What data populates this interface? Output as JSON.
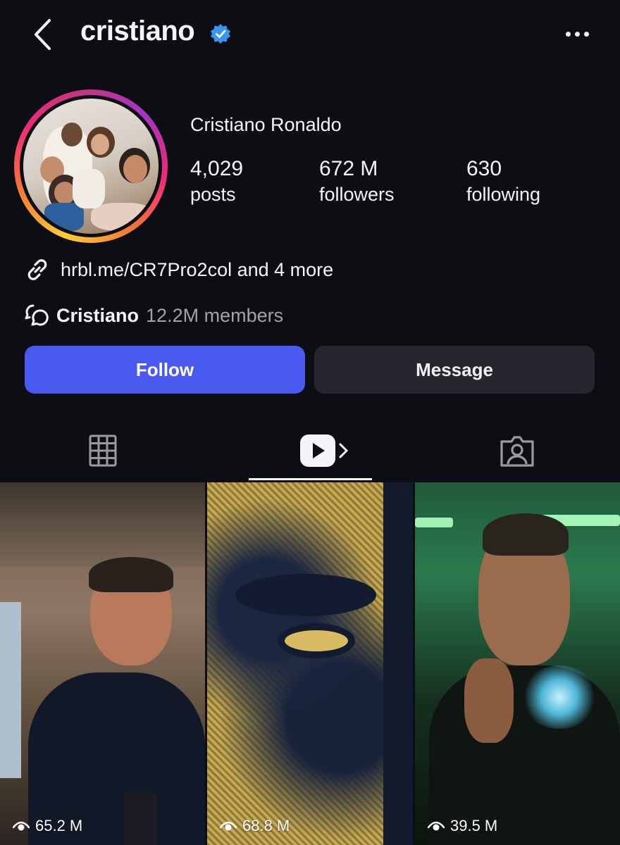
{
  "header": {
    "username": "cristiano",
    "back_icon": "chevron-left-icon",
    "verified_icon": "verified-badge-icon",
    "more_icon": "more-horizontal-icon",
    "accent_color": "#3797f0"
  },
  "profile": {
    "full_name": "Cristiano Ronaldo",
    "stats": [
      {
        "value": "4,029",
        "label": "posts"
      },
      {
        "value": "672 M",
        "label": "followers"
      },
      {
        "value": "630",
        "label": "following"
      }
    ],
    "link": {
      "icon": "link-icon",
      "text": "hrbl.me/CR7Pro2col and 4 more"
    },
    "channel": {
      "icon": "channel-icon",
      "name": "Cristiano",
      "members": "12.2M members"
    }
  },
  "actions": {
    "follow_label": "Follow",
    "message_label": "Message",
    "follow_color": "#4a5af0",
    "message_color": "#26272e"
  },
  "tabs": [
    {
      "name": "grid",
      "icon": "grid-icon",
      "active": false
    },
    {
      "name": "reels",
      "icon": "reels-play-icon",
      "active": true
    },
    {
      "name": "tagged",
      "icon": "tagged-person-icon",
      "active": false
    }
  ],
  "reels": [
    {
      "views": "65.2 M",
      "icon": "eye-icon"
    },
    {
      "views": "68.8 M",
      "icon": "eye-icon"
    },
    {
      "views": "39.5 M",
      "icon": "eye-icon"
    }
  ]
}
